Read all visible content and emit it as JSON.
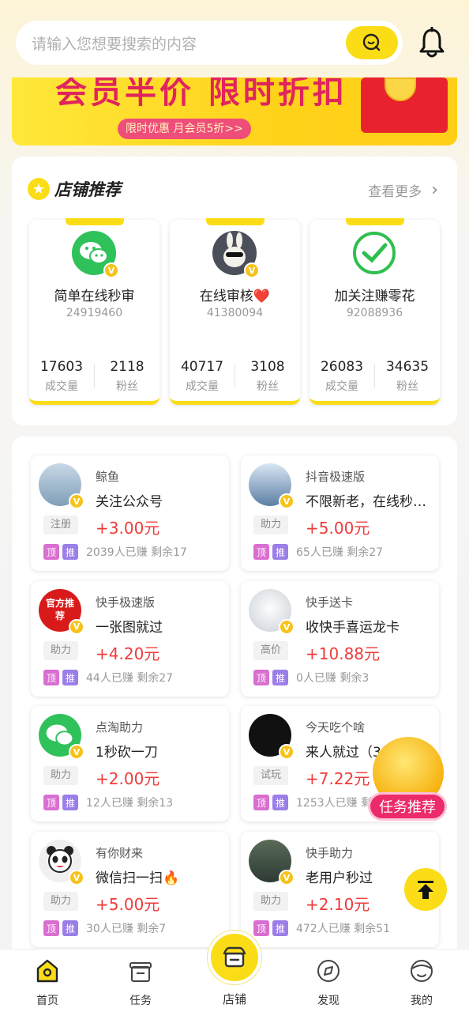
{
  "search": {
    "placeholder": "请输入您想要搜索的内容"
  },
  "banner": {
    "title": "会员半价 限时折扣",
    "pill": "限时优惠 月会员5折>>"
  },
  "shops": {
    "title": "店铺推荐",
    "more": "查看更多",
    "items": [
      {
        "name": "简单在线秒审",
        "id": "24919460",
        "deals": "17603",
        "deals_label": "成交量",
        "fans": "2118",
        "fans_label": "粉丝"
      },
      {
        "name": "在线审核❤️",
        "id": "41380094",
        "deals": "40717",
        "deals_label": "成交量",
        "fans": "3108",
        "fans_label": "粉丝"
      },
      {
        "name": "加关注赚零花",
        "id": "92088936",
        "deals": "26083",
        "deals_label": "成交量",
        "fans": "34635",
        "fans_label": "粉丝"
      }
    ]
  },
  "tags": {
    "ding": "顶",
    "tui": "推"
  },
  "tasks": [
    {
      "platform": "鲸鱼",
      "title": "关注公众号",
      "category": "注册",
      "price": "+3.00元",
      "stats": "2039人已赚 剩余17"
    },
    {
      "platform": "抖音极速版",
      "title": "不限新老，在线秒审...",
      "category": "助力",
      "price": "+5.00元",
      "stats": "65人已赚 剩余27"
    },
    {
      "platform": "快手极速版",
      "title": "一张图就过",
      "category": "助力",
      "price": "+4.20元",
      "stats": "44人已赚 剩余27"
    },
    {
      "platform": "快手送卡",
      "title": "收快手喜运龙卡",
      "category": "高价",
      "price": "+10.88元",
      "stats": "0人已赚 剩余3"
    },
    {
      "platform": "点淘助力",
      "title": "1秒砍一刀",
      "category": "助力",
      "price": "+2.00元",
      "stats": "12人已赚 剩余13"
    },
    {
      "platform": "今天吃个啥",
      "title": "来人就过（3",
      "category": "试玩",
      "price": "+7.22元",
      "stats": "1253人已赚 剩余"
    },
    {
      "platform": "有你财来",
      "title": "微信扫一扫🔥",
      "category": "助力",
      "price": "+5.00元",
      "stats": "30人已赚 剩余7"
    },
    {
      "platform": "快手助力",
      "title": "老用户秒过",
      "category": "助力",
      "price": "+2.10元",
      "stats": "472人已赚 剩余51"
    }
  ],
  "avatar_text": {
    "kuaishou": "官方推荐"
  },
  "float": {
    "label": "任务推荐"
  },
  "tabbar": {
    "home": "首页",
    "task": "任务",
    "shop": "店铺",
    "discover": "发现",
    "mine": "我的"
  },
  "colors": {
    "accent": "#fbdd17",
    "price": "#ef3b3b",
    "rec": "#ec2b6a"
  }
}
